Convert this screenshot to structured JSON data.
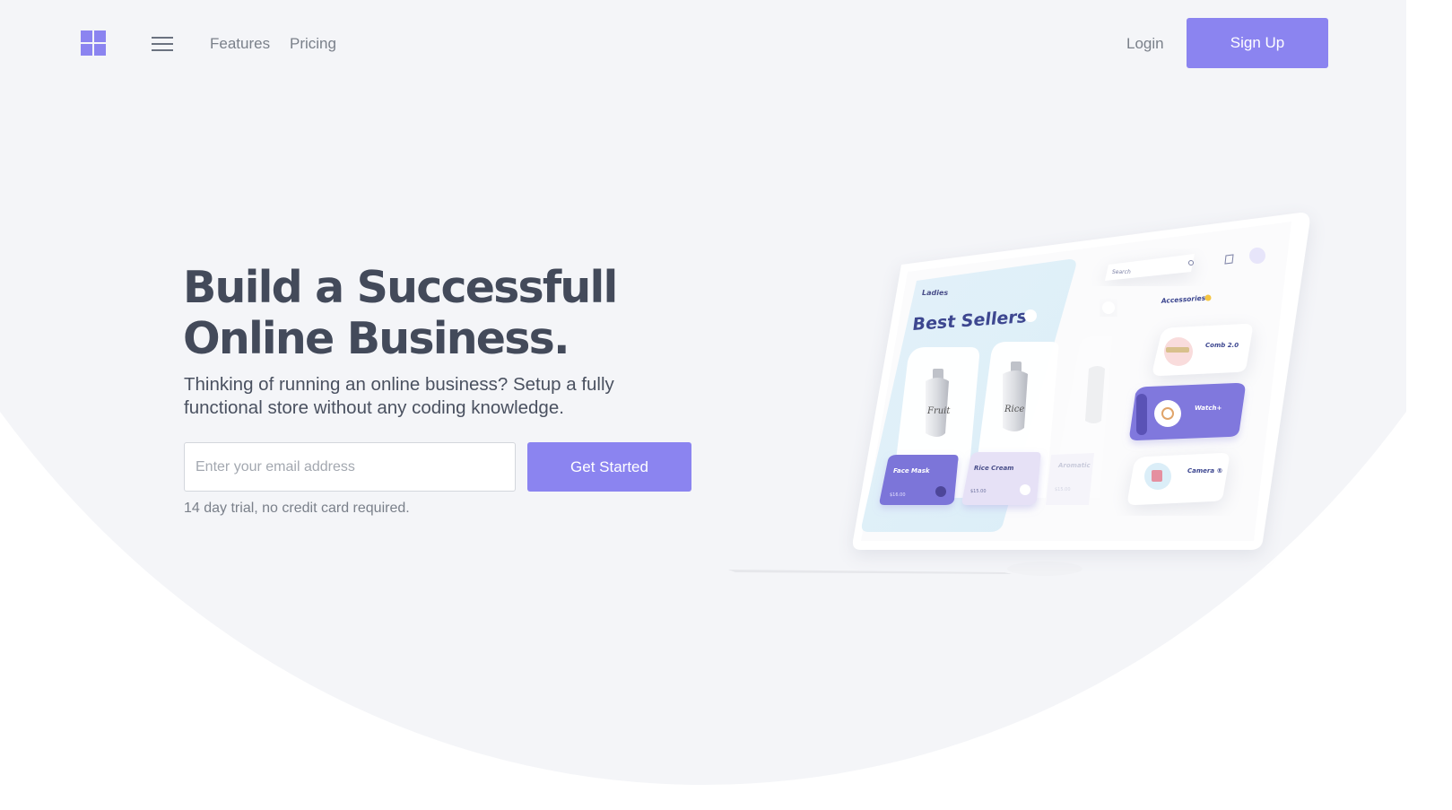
{
  "header": {
    "logo": "grid-logo",
    "menu_icon": "hamburger-menu-icon",
    "nav": [
      {
        "label": "Features"
      },
      {
        "label": "Pricing"
      }
    ],
    "login_label": "Login",
    "signup_label": "Sign Up"
  },
  "hero": {
    "title_line1": "Build a Successfull",
    "title_line2": "Online Business.",
    "subtitle": "Thinking of running an online business? Setup a fully functional store without any coding knowledge.",
    "email_placeholder": "Enter your email address",
    "email_value": "",
    "cta_label": "Get Started",
    "trial_note": "14 day trial, no credit card required."
  },
  "mockup": {
    "store_brand": "Ladies",
    "section_title": "Best Sellers",
    "search_placeholder": "Search",
    "accessories_label": "Accessories",
    "products": [
      {
        "bottle_label": "Fruit",
        "name": "Face Mask",
        "price": "$16.00"
      },
      {
        "bottle_label": "Rice",
        "name": "Rice Cream",
        "price": "$15.00"
      },
      {
        "bottle_label": "",
        "name": "Aromatic",
        "price": "$15.00"
      }
    ],
    "accessories": [
      {
        "name": "Comb 2.0"
      },
      {
        "name": "Watch+"
      },
      {
        "name": "Camera ®"
      }
    ]
  },
  "colors": {
    "accent": "#8b84f0",
    "heading": "#434a5a",
    "muted_text": "#7a808a",
    "hero_background": "#f4f5f8"
  }
}
